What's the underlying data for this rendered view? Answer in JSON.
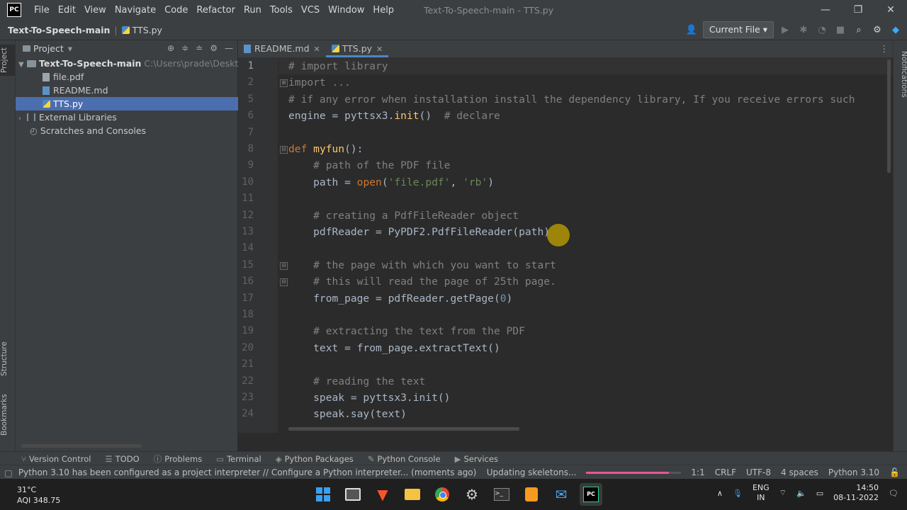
{
  "titlebar": {
    "logo": "PC",
    "menu": [
      "File",
      "Edit",
      "View",
      "Navigate",
      "Code",
      "Refactor",
      "Run",
      "Tools",
      "VCS",
      "Window",
      "Help"
    ],
    "window_title": "Text-To-Speech-main - TTS.py",
    "minimize": "—",
    "maximize": "❐",
    "close": "✕"
  },
  "navbar": {
    "project": "Text-To-Speech-main",
    "file": "TTS.py",
    "run_config": "Current File"
  },
  "left_stripe": {
    "project": "Project",
    "structure": "Structure",
    "bookmarks": "Bookmarks"
  },
  "right_stripe": {
    "notifications": "Notifications"
  },
  "project_panel": {
    "title": "Project",
    "root": "Text-To-Speech-main",
    "root_path": "C:\\Users\\prade\\Desktop\\T",
    "files": [
      "file.pdf",
      "README.md",
      "TTS.py"
    ],
    "external": "External Libraries",
    "scratches": "Scratches and Consoles"
  },
  "editor_tabs": [
    {
      "label": "README.md"
    },
    {
      "label": "TTS.py"
    }
  ],
  "code": {
    "line_numbers": [
      "1",
      "2",
      "5",
      "6",
      "7",
      "8",
      "9",
      "10",
      "11",
      "12",
      "13",
      "14",
      "15",
      "16",
      "17",
      "18",
      "19",
      "20",
      "21",
      "22",
      "23",
      "24"
    ],
    "lines": [
      {
        "segments": [
          {
            "t": "# import library",
            "c": "cm"
          }
        ]
      },
      {
        "segments": [
          {
            "t": "import ...",
            "c": "cm"
          }
        ]
      },
      {
        "segments": [
          {
            "t": "# if any error when installation install the dependency library, If you receive errors such",
            "c": "cm"
          }
        ]
      },
      {
        "segments": [
          {
            "t": "engine = pyttsx3.",
            "c": ""
          },
          {
            "t": "init",
            "c": "fn"
          },
          {
            "t": "()  ",
            "c": ""
          },
          {
            "t": "# declare",
            "c": "cm"
          }
        ]
      },
      {
        "segments": []
      },
      {
        "segments": [
          {
            "t": "def ",
            "c": "kw"
          },
          {
            "t": "myfun",
            "c": "fn"
          },
          {
            "t": "():",
            "c": ""
          }
        ]
      },
      {
        "segments": [
          {
            "t": "    # path of the PDF file",
            "c": "cm"
          }
        ]
      },
      {
        "segments": [
          {
            "t": "    path = ",
            "c": ""
          },
          {
            "t": "open",
            "c": "kw"
          },
          {
            "t": "(",
            "c": ""
          },
          {
            "t": "'file.pdf'",
            "c": "str"
          },
          {
            "t": ", ",
            "c": ""
          },
          {
            "t": "'rb'",
            "c": "str"
          },
          {
            "t": ")",
            "c": ""
          }
        ]
      },
      {
        "segments": []
      },
      {
        "segments": [
          {
            "t": "    # creating a PdfFileReader object",
            "c": "cm"
          }
        ]
      },
      {
        "segments": [
          {
            "t": "    pdfReader = PyPDF2.PdfFileReader(path)",
            "c": ""
          }
        ]
      },
      {
        "segments": []
      },
      {
        "segments": [
          {
            "t": "    # the page with which you want to start",
            "c": "cm"
          }
        ]
      },
      {
        "segments": [
          {
            "t": "    # this will read the page of 25th page.",
            "c": "cm"
          }
        ]
      },
      {
        "segments": [
          {
            "t": "    from_page = pdfReader.getPage(",
            "c": ""
          },
          {
            "t": "0",
            "c": "num"
          },
          {
            "t": ")",
            "c": ""
          }
        ]
      },
      {
        "segments": []
      },
      {
        "segments": [
          {
            "t": "    # extracting the text from the PDF",
            "c": "cm"
          }
        ]
      },
      {
        "segments": [
          {
            "t": "    text = from_page.extractText()",
            "c": ""
          }
        ]
      },
      {
        "segments": []
      },
      {
        "segments": [
          {
            "t": "    # reading the text",
            "c": "cm"
          }
        ]
      },
      {
        "segments": [
          {
            "t": "    speak = pyttsx3.init()",
            "c": ""
          }
        ]
      },
      {
        "segments": [
          {
            "t": "    speak.say(text)",
            "c": ""
          }
        ]
      }
    ]
  },
  "bottom_tools": [
    "Version Control",
    "TODO",
    "Problems",
    "Terminal",
    "Python Packages",
    "Python Console",
    "Services"
  ],
  "statusbar": {
    "message": "Python 3.10 has been configured as a project interpreter // Configure a Python interpreter... (moments ago)",
    "task": "Updating skeletons...",
    "progress": 0.87,
    "position": "1:1",
    "line_sep": "CRLF",
    "encoding": "UTF-8",
    "indent": "4 spaces",
    "interpreter": "Python 3.10"
  },
  "taskbar": {
    "temp": "31°C",
    "aqi": "AQI 348.75",
    "lang1": "ENG",
    "lang2": "IN",
    "time": "14:50",
    "date": "08-11-2022"
  },
  "colors": {
    "selection": "#4b6eaf",
    "accent_tab": "#4a88c7",
    "progress": "#e85694"
  }
}
